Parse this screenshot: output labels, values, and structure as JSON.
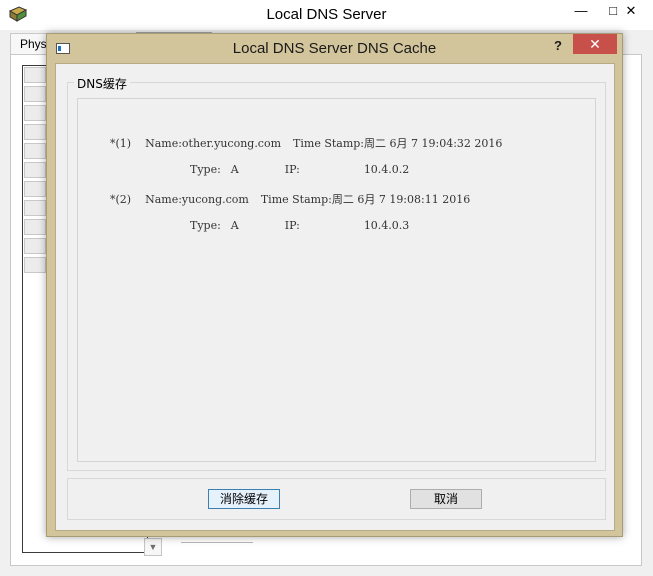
{
  "main_window": {
    "title": "Local DNS Server",
    "controls": {
      "minimize": "—",
      "maximize": "□",
      "close": "✕"
    },
    "tabs": [
      {
        "label": "Phys"
      }
    ],
    "icons": {
      "app": "app-icon"
    }
  },
  "dialog": {
    "title": "Local DNS Server DNS Cache",
    "help_label": "?",
    "close_label": "✕",
    "group_label": "DNS缓存",
    "cache_entries": [
      {
        "index": "*(1)",
        "name_label": "Name:",
        "name": "other.yucong.com",
        "timestamp_label": "Time Stamp:",
        "timestamp": "周二 6月 7 19:04:32 2016",
        "type_label": "Type:",
        "type": "A",
        "ip_label": "IP:",
        "ip": "10.4.0.2"
      },
      {
        "index": "*(2)",
        "name_label": "Name:",
        "name": "yucong.com",
        "timestamp_label": "Time Stamp:",
        "timestamp": "周二 6月 7 19:08:11 2016",
        "type_label": "Type:",
        "type": "A",
        "ip_label": "IP:",
        "ip": "10.4.0.3"
      }
    ],
    "buttons": {
      "clear_cache": "消除缓存",
      "cancel": "取消"
    },
    "colors": {
      "frame": "#d2c49b",
      "close_button": "#c7504b",
      "client_bg": "#f0f0f0"
    }
  }
}
